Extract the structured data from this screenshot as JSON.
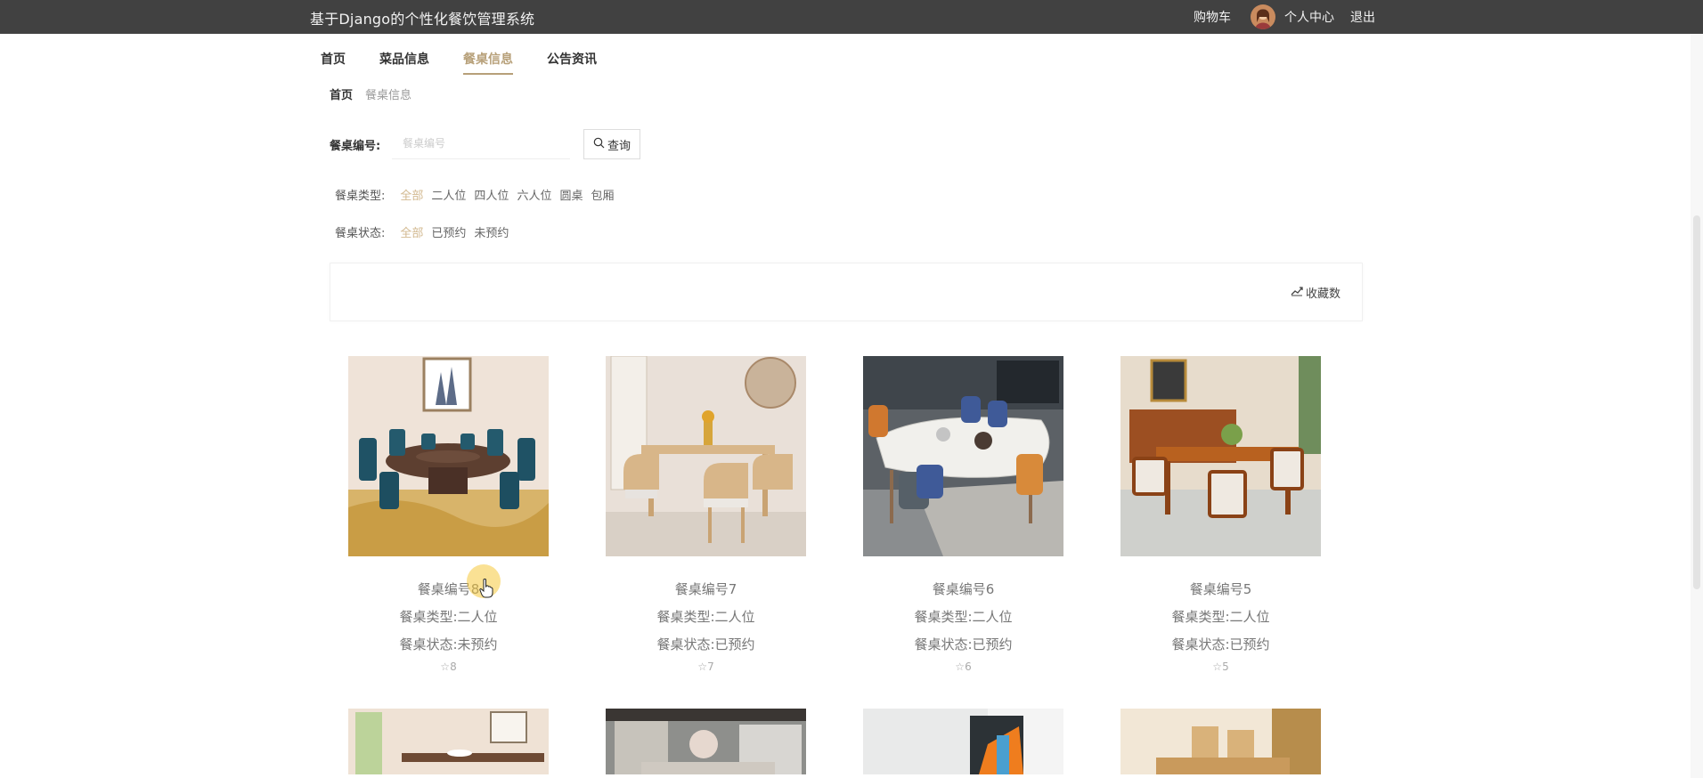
{
  "header": {
    "brand": "基于Django的个性化餐饮管理系统",
    "cart": "购物车",
    "profile": "个人中心",
    "logout": "退出"
  },
  "nav": {
    "home": "首页",
    "dishes": "菜品信息",
    "tables": "餐桌信息",
    "news": "公告资讯"
  },
  "breadcrumb": {
    "home": "首页",
    "current": "餐桌信息"
  },
  "search": {
    "label": "餐桌编号:",
    "placeholder": "餐桌编号",
    "button": "查询"
  },
  "filters": {
    "type": {
      "label": "餐桌类型:",
      "options": [
        "全部",
        "二人位",
        "四人位",
        "六人位",
        "圆桌",
        "包厢"
      ],
      "selected": "全部"
    },
    "status": {
      "label": "餐桌状态:",
      "options": [
        "全部",
        "已预约",
        "未预约"
      ],
      "selected": "全部"
    }
  },
  "sort": {
    "favorites": "收藏数"
  },
  "cards": [
    {
      "title": "餐桌编号8",
      "type": "餐桌类型:二人位",
      "status": "餐桌状态:未预约",
      "likes": "8"
    },
    {
      "title": "餐桌编号7",
      "type": "餐桌类型:二人位",
      "status": "餐桌状态:已预约",
      "likes": "7"
    },
    {
      "title": "餐桌编号6",
      "type": "餐桌类型:二人位",
      "status": "餐桌状态:已预约",
      "likes": "6"
    },
    {
      "title": "餐桌编号5",
      "type": "餐桌类型:二人位",
      "status": "餐桌状态:已预约",
      "likes": "5"
    }
  ],
  "colors": {
    "header_bg": "#414141",
    "accent": "#b7a079",
    "filter_selected": "#d2b88f"
  },
  "icons": {
    "search": "search-icon",
    "sort": "sort-chart-icon",
    "star": "star-icon",
    "avatar": "avatar"
  }
}
